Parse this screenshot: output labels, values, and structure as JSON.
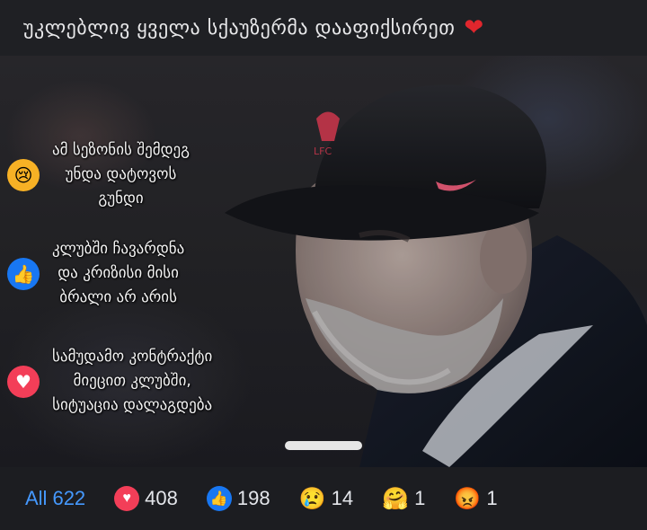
{
  "header": {
    "caption": "უკლებლივ ყველა სქაუზერმა დააფიქსირეთ",
    "heart_icon": "red-heart"
  },
  "reaction_options": [
    {
      "icon": "sad-face",
      "color": "#f7b125",
      "text": "ამ სეზონის შემდეგ\nუნდა დატოვოს\nგუნდი"
    },
    {
      "icon": "thumbs-up",
      "color": "#1877f2",
      "text": "კლუბში ჩავარდნა\nდა კრიზისი მისი\nბრალი არ არის"
    },
    {
      "icon": "heart",
      "color": "#f33e58",
      "text": "სამუდამო კონტრაქტი\nმიეცით კლუბში,\nსიტუაცია დალაგდება"
    }
  ],
  "reactions_bar": {
    "all_label": "All",
    "all_count": "622",
    "items": [
      {
        "icon": "love",
        "emoji": "♥",
        "count": "408"
      },
      {
        "icon": "like",
        "emoji": "👍",
        "count": "198"
      },
      {
        "icon": "sad",
        "emoji": "😢",
        "count": "14"
      },
      {
        "icon": "care",
        "emoji": "🤗",
        "count": "1"
      },
      {
        "icon": "angry",
        "emoji": "😡",
        "count": "1"
      }
    ]
  },
  "colors": {
    "accent_blue": "#4599ff",
    "love_red": "#f33e58",
    "like_blue": "#1877f2",
    "sad_yellow": "#f7b125"
  }
}
